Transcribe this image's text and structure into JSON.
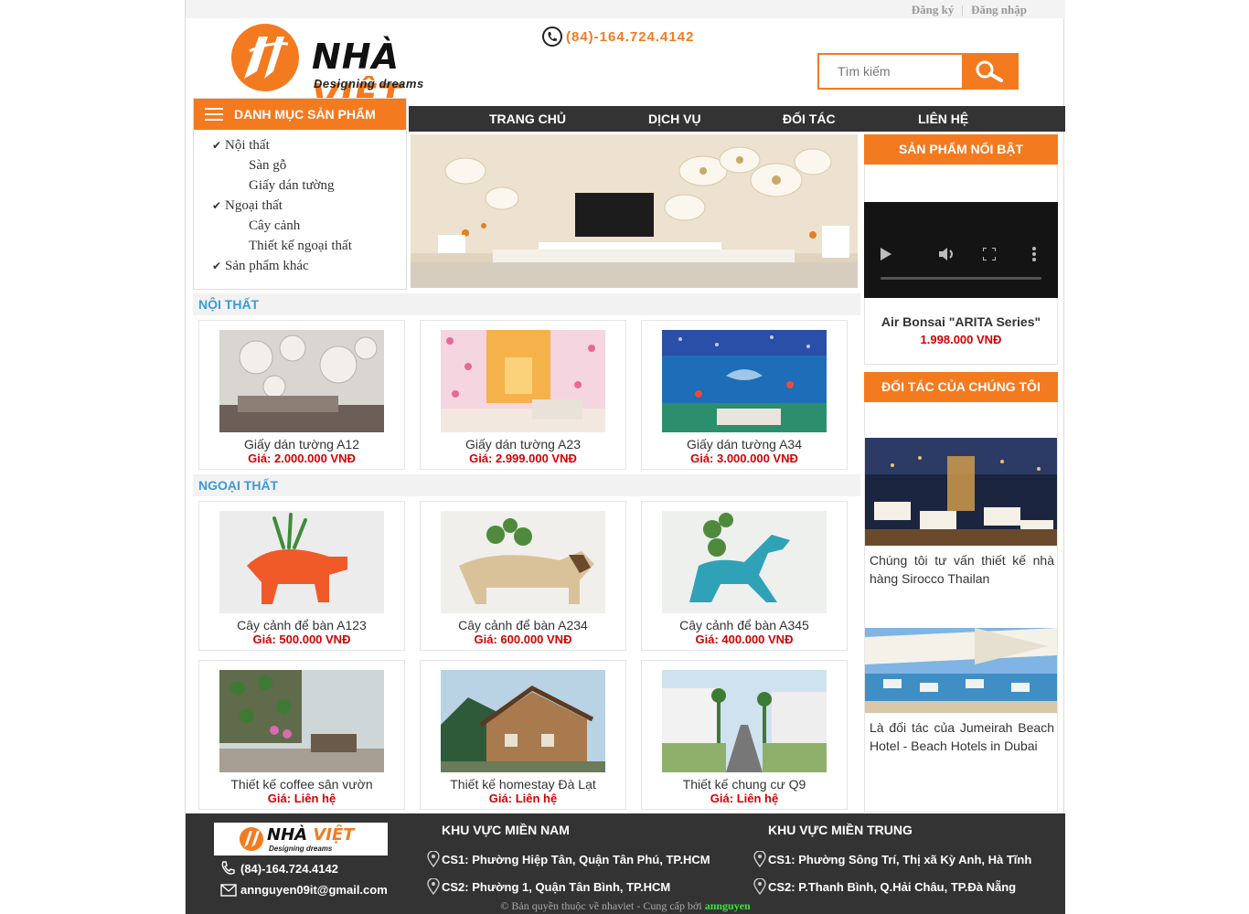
{
  "topbar": {
    "register": "Đăng ký",
    "login": "Đăng nhập"
  },
  "logo": {
    "brand_part1": "NHÀ",
    "brand_part2": "VIỆT",
    "tagline": "Designing dreams"
  },
  "header": {
    "phone": "(84)-164.724.4142"
  },
  "search": {
    "placeholder": "Tìm kiếm"
  },
  "nav": {
    "items": [
      "TRANG CHỦ",
      "DỊCH VỤ",
      "ĐỐI TÁC",
      "LIÊN HỆ"
    ]
  },
  "category_menu": {
    "title": "DANH MỤC SẢN PHẨM",
    "items": [
      {
        "label": "Nội thất",
        "level": "top"
      },
      {
        "label": "Sàn gỗ",
        "level": "sub"
      },
      {
        "label": "Giấy dán tường",
        "level": "sub"
      },
      {
        "label": "Ngoại thất",
        "level": "top"
      },
      {
        "label": "Cây cảnh",
        "level": "sub"
      },
      {
        "label": "Thiết kế ngoại thất",
        "level": "sub"
      },
      {
        "label": "Sản phẩm khác",
        "level": "top"
      }
    ]
  },
  "sections": {
    "interior": {
      "title": "NỘI THẤT",
      "products": [
        {
          "name": "Giấy dán tường A12",
          "price": "Giá: 2.000.000 VNĐ"
        },
        {
          "name": "Giấy dán tường A23",
          "price": "Giá: 2.999.000 VNĐ"
        },
        {
          "name": "Giấy dán tường A34",
          "price": "Giá: 3.000.000 VNĐ"
        }
      ]
    },
    "exterior": {
      "title": "NGOẠI THẤT",
      "products": [
        {
          "name": "Cây cảnh để bàn A123",
          "price": "Giá: 500.000 VNĐ"
        },
        {
          "name": "Cây cảnh để bàn A234",
          "price": "Giá: 600.000 VNĐ"
        },
        {
          "name": "Cây cảnh để bàn A345",
          "price": "Giá: 400.000 VNĐ"
        },
        {
          "name": "Thiết kế coffee sân vườn",
          "price": "Giá: Liên hệ"
        },
        {
          "name": "Thiết kế homestay Đà Lạt",
          "price": "Giá: Liên hệ"
        },
        {
          "name": "Thiết kế chung cư Q9",
          "price": "Giá: Liên hệ"
        }
      ]
    }
  },
  "sidebar": {
    "featured": {
      "title": "SẢN PHẨM NỔI BẬT",
      "name": "Air Bonsai \"ARITA Series\"",
      "price": "1.998.000 VNĐ"
    },
    "partners": {
      "title": "ĐỐI TÁC CỦA CHÚNG TÔI",
      "items": [
        "Chúng tôi tư vấn thiết kế nhà hàng Sirocco Thailan",
        "Là đối tác của Jumeirah Beach Hotel - Beach Hotels in Dubai"
      ]
    }
  },
  "footer": {
    "phone": "(84)-164.724.4142",
    "email": "annguyen09it@gmail.com",
    "south_title": "KHU VỰC MIỀN NAM",
    "south": [
      "CS1: Phường Hiệp Tân, Quận Tân Phú, TP.HCM",
      "CS2: Phường 1, Quận Tân Bình, TP.HCM"
    ],
    "central_title": "KHU VỰC MIỀN TRUNG",
    "central": [
      "CS1: Phường Sông Trí, Thị xã Kỳ Anh, Hà Tĩnh",
      "CS2: P.Thanh Bình, Q.Hải Châu, TP.Đà Nẵng"
    ],
    "copyright": "© Bản quyền thuộc về nhaviet - Cung cấp bởi",
    "author": "annguyen"
  },
  "colors": {
    "accent": "#f47a20",
    "nav_bg": "#333333",
    "price": "#d60000",
    "section_title": "#3a9ad9"
  }
}
